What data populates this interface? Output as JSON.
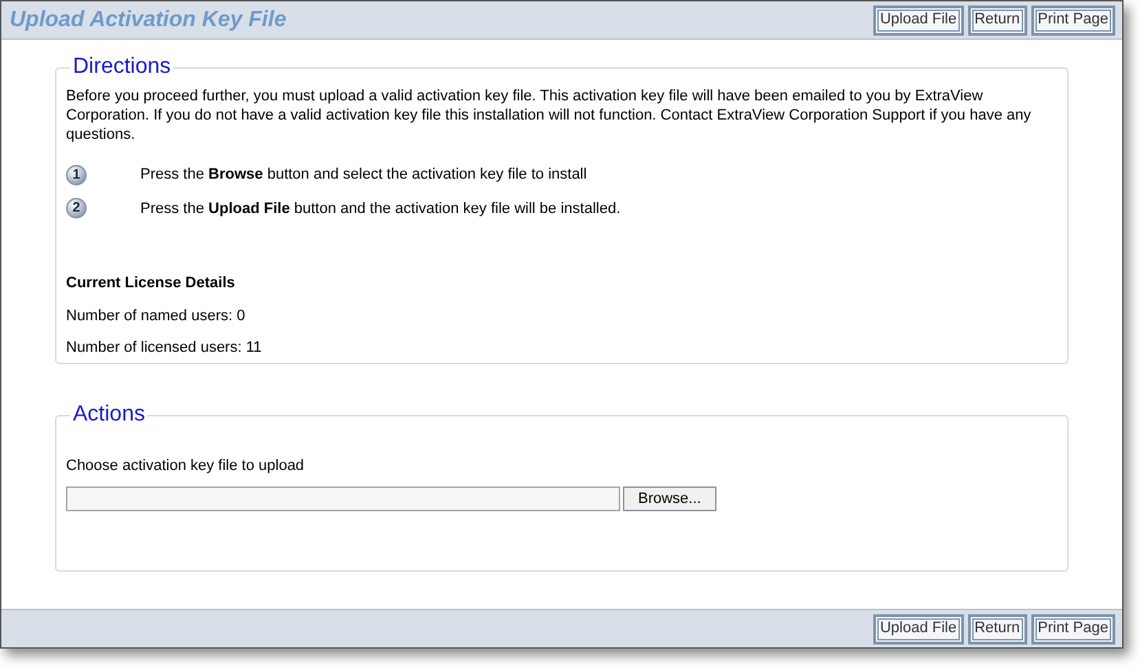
{
  "header": {
    "title": "Upload Activation Key File",
    "buttons": [
      "Upload File",
      "Return",
      "Print Page"
    ]
  },
  "directions": {
    "legend": "Directions",
    "intro": "Before you proceed further, you must upload a valid activation key file. This activation key file will have been emailed to you by ExtraView Corporation. If you do not have a valid activation key file this installation will not function. Contact ExtraView Corporation Support if you have any questions.",
    "steps": [
      {
        "number": "1",
        "text": "Press the **Browse** button and select the activation key file to install"
      },
      {
        "number": "2",
        "text": "Press the **Upload File** button and the activation key file will be installed."
      }
    ],
    "license_heading": "Current License Details",
    "license_lines": [
      "Number of named users: 0",
      "Number of licensed users: 11"
    ]
  },
  "actions": {
    "legend": "Actions",
    "label": "Choose activation key file to upload",
    "browse_button": "Browse..."
  },
  "footer": {
    "buttons": [
      "Upload File",
      "Return",
      "Print Page"
    ]
  }
}
